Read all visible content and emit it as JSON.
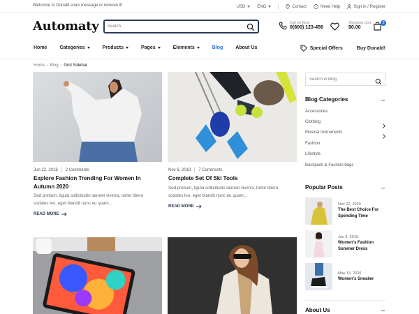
{
  "topbar": {
    "welcome": "Welcome to Donald store message or remove it!",
    "currency": "USD",
    "language": "ENG",
    "contact": "Contact",
    "help": "Need Help",
    "signin": "Sign in / Register"
  },
  "header": {
    "logo": "Automaty",
    "search_placeholder": "Search",
    "call_label": "Call Us Now:",
    "call_number": "0(800) 123-456",
    "cart_label": "Shopping Cart:",
    "cart_amount": "$0.00",
    "cart_count": "0"
  },
  "nav": {
    "items": [
      {
        "label": "Home"
      },
      {
        "label": "Categories"
      },
      {
        "label": "Products"
      },
      {
        "label": "Pages"
      },
      {
        "label": "Elements"
      },
      {
        "label": "Blog"
      },
      {
        "label": "About Us"
      }
    ],
    "special_offers": "Special Offers",
    "buy": "Buy Donald!"
  },
  "breadcrumb": [
    "Home",
    "Blog",
    "Grid Sidebar"
  ],
  "posts": [
    {
      "date": "Jun 22, 2018",
      "comments": "2 Comments",
      "title_line1": "Explore Fashion Trending For Women In",
      "title_line2": "Autumn 2020",
      "excerpt_line1": "Sed pretium, ligula sollicitudin laoreet viverra, tortor libero",
      "excerpt_line2": "sodales leo, eget blandit nunc eu quam...",
      "readmore": "READ MORE"
    },
    {
      "date": "Nov 6, 2019",
      "comments": "7 Comments",
      "title_line1": "Complete Set Of Ski Tools",
      "excerpt_line1": "Sed pretium, ligula sollicitudin laoreet viverra, tortor libero",
      "excerpt_line2": "sodales leo, eget blandit nunc eu quam...",
      "readmore": "READ MORE"
    }
  ],
  "sidebar": {
    "search_placeholder": "Search in Blog",
    "categories_title": "Blog Categories",
    "categories": [
      {
        "label": "Accessories"
      },
      {
        "label": "Clothing"
      },
      {
        "label": "Musical Instruments"
      },
      {
        "label": "Fashion"
      },
      {
        "label": "Lifestyle"
      },
      {
        "label": "Backpack & Fashion bags"
      }
    ],
    "popular_title": "Popular Posts",
    "popular": [
      {
        "date": "Nov 22, 2020",
        "title_line1": "The Best Choice For",
        "title_line2": "Spending Time"
      },
      {
        "date": "Jun 6, 2019",
        "title_line1": "Women's Fashion",
        "title_line2": "Summer Dress"
      },
      {
        "date": "May 13, 2020",
        "title_line1": "Women's Sneaker",
        "title_line2": ""
      }
    ],
    "about_title": "About Us"
  },
  "colors": {
    "accent": "#2a6fd6",
    "navy": "#2b3a55"
  }
}
